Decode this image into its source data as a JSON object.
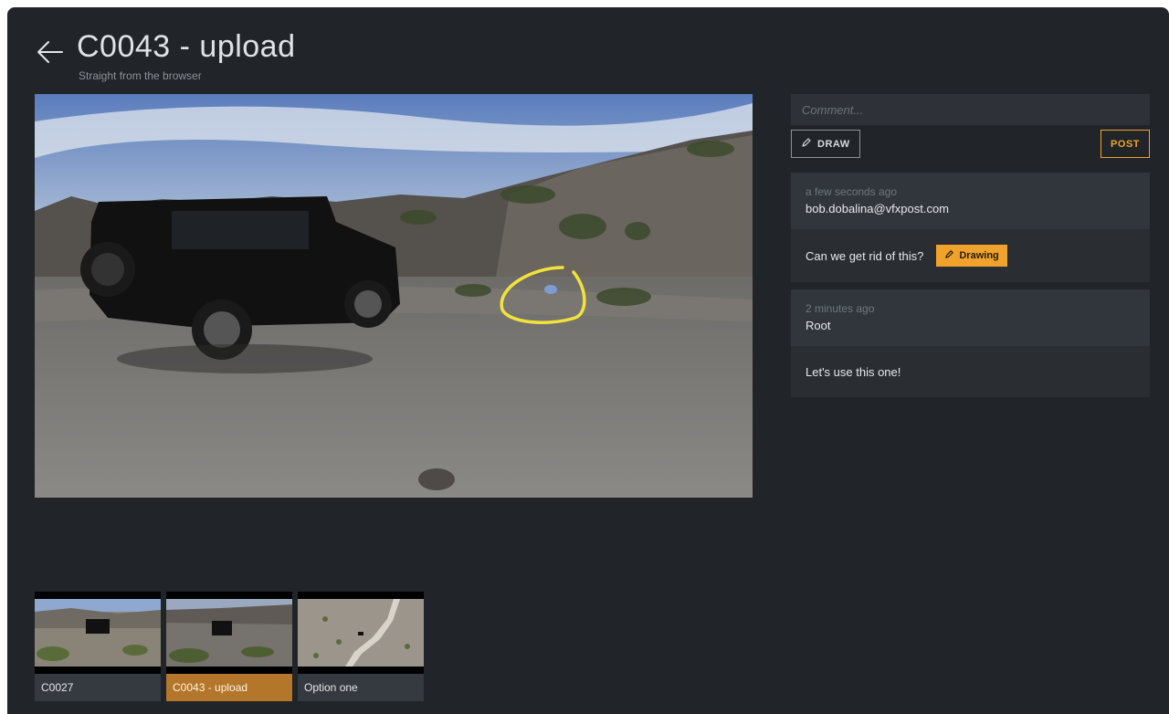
{
  "header": {
    "title": "C0043 - upload",
    "subtitle": "Straight from the browser"
  },
  "comment_form": {
    "placeholder": "Comment...",
    "draw_label": "DRAW",
    "post_label": "POST"
  },
  "comments": [
    {
      "time": "a few seconds ago",
      "author": "bob.dobalina@vfxpost.com",
      "text": "Can we get rid of this?",
      "badge": "Drawing"
    },
    {
      "time": "2 minutes ago",
      "author": "Root",
      "text": "Let's use this one!"
    }
  ],
  "filmstrip": [
    {
      "label": "C0027",
      "active": false
    },
    {
      "label": "C0043 - upload",
      "active": true
    },
    {
      "label": "Option one",
      "active": false
    }
  ],
  "colors": {
    "accent": "#f0a32c",
    "annotation": "#f2e33a",
    "background": "#212428",
    "active_thumb": "#b3762a"
  }
}
